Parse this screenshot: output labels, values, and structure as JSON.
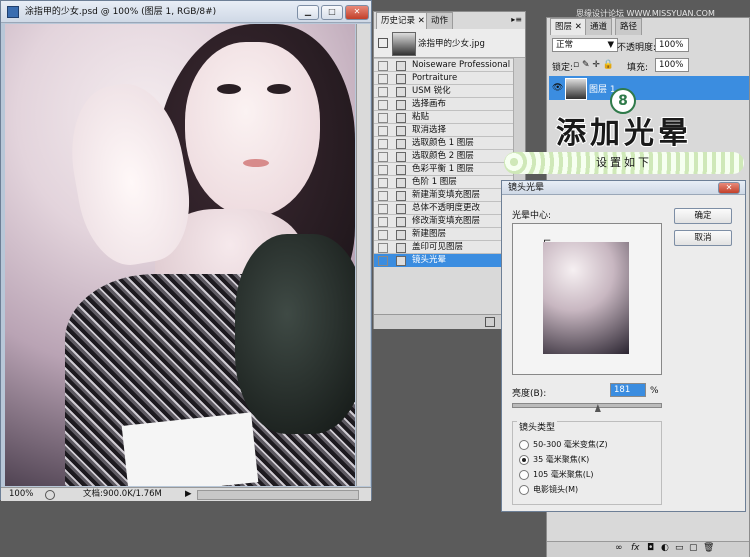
{
  "watermark": "思缘设计论坛 WWW.MISSYUAN.COM",
  "document": {
    "title": "涂指甲的少女.psd @ 100% (图层 1, RGB/8#)",
    "zoom": "100%",
    "status": "文档:900.0K/1.76M"
  },
  "history_panel": {
    "tabs": [
      "历史记录",
      "动作"
    ],
    "snapshot_label": "涂指甲的少女.jpg",
    "items": [
      "Noiseware Professional",
      "Portraiture",
      "USM 锐化",
      "选择画布",
      "粘贴",
      "取消选择",
      "选取颜色 1 图层",
      "选取颜色 2 图层",
      "色彩平衡 1 图层",
      "色阶 1 图层",
      "新建渐变填充图层",
      "总体不透明度更改",
      "修改渐变填充图层",
      "新建图层",
      "盖印可见图层",
      "镜头光晕"
    ],
    "selected_index": 15
  },
  "layers_panel": {
    "tabs": [
      "图层",
      "通道",
      "路径"
    ],
    "blend_mode": "正常",
    "opacity_label": "不透明度:",
    "opacity_value": "100%",
    "lock_label": "锁定:",
    "fill_label": "填充:",
    "fill_value": "100%",
    "layer_name": "图层 1"
  },
  "banner": {
    "step_number": "8",
    "title": "添加光晕",
    "subtitle": "设置如下"
  },
  "lens_flare_dialog": {
    "title": "镜头光晕",
    "center_label": "光晕中心:",
    "ok_label": "确定",
    "cancel_label": "取消",
    "brightness_label": "亮度(B):",
    "brightness_value": "181",
    "percent_sign": "%",
    "brightness_level": 0.58,
    "lens_type_label": "镜头类型",
    "lens_options": [
      "50-300 毫米变焦(Z)",
      "35 毫米聚焦(K)",
      "105 毫米聚焦(L)",
      "电影镜头(M)"
    ],
    "selected_option": 1
  },
  "colors": {
    "selection_blue": "#3b8de0",
    "accent_green": "#2f7a4a"
  }
}
